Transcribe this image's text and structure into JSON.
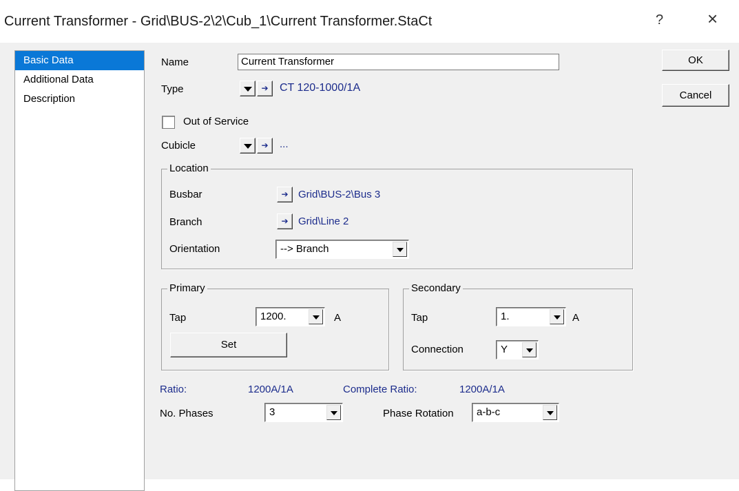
{
  "window": {
    "title": "Current Transformer - Grid\\BUS-2\\2\\Cub_1\\Current Transformer.StaCt",
    "help_label": "?",
    "close_label": "×"
  },
  "nav": {
    "items": [
      {
        "label": "Basic Data",
        "active": true
      },
      {
        "label": "Additional Data",
        "active": false
      },
      {
        "label": "Description",
        "active": false
      }
    ]
  },
  "buttons": {
    "ok": "OK",
    "cancel": "Cancel",
    "set": "Set"
  },
  "basic": {
    "name_label": "Name",
    "name_value": "Current Transformer",
    "type_label": "Type",
    "type_value": "CT 120-1000/1A",
    "out_of_service_label": "Out of Service",
    "out_of_service_checked": false,
    "cubicle_label": "Cubicle",
    "cubicle_value": "..."
  },
  "location": {
    "title": "Location",
    "busbar_label": "Busbar",
    "busbar_value": "Grid\\BUS-2\\Bus 3",
    "branch_label": "Branch",
    "branch_value": "Grid\\Line 2",
    "orientation_label": "Orientation",
    "orientation_value": "--> Branch"
  },
  "primary": {
    "title": "Primary",
    "tap_label": "Tap",
    "tap_value": "1200.",
    "unit": "A"
  },
  "secondary": {
    "title": "Secondary",
    "tap_label": "Tap",
    "tap_value": "1.",
    "unit": "A",
    "connection_label": "Connection",
    "connection_value": "Y"
  },
  "ratio": {
    "ratio_label": "Ratio:",
    "ratio_value": "1200A/1A",
    "complete_label": "Complete Ratio:",
    "complete_value": "1200A/1A"
  },
  "phases": {
    "label": "No. Phases",
    "value": "3",
    "rotation_label": "Phase Rotation",
    "rotation_value": "a-b-c"
  },
  "icons": {
    "dropdown": "triangle-down-icon",
    "jump": "arrow-right-icon"
  }
}
